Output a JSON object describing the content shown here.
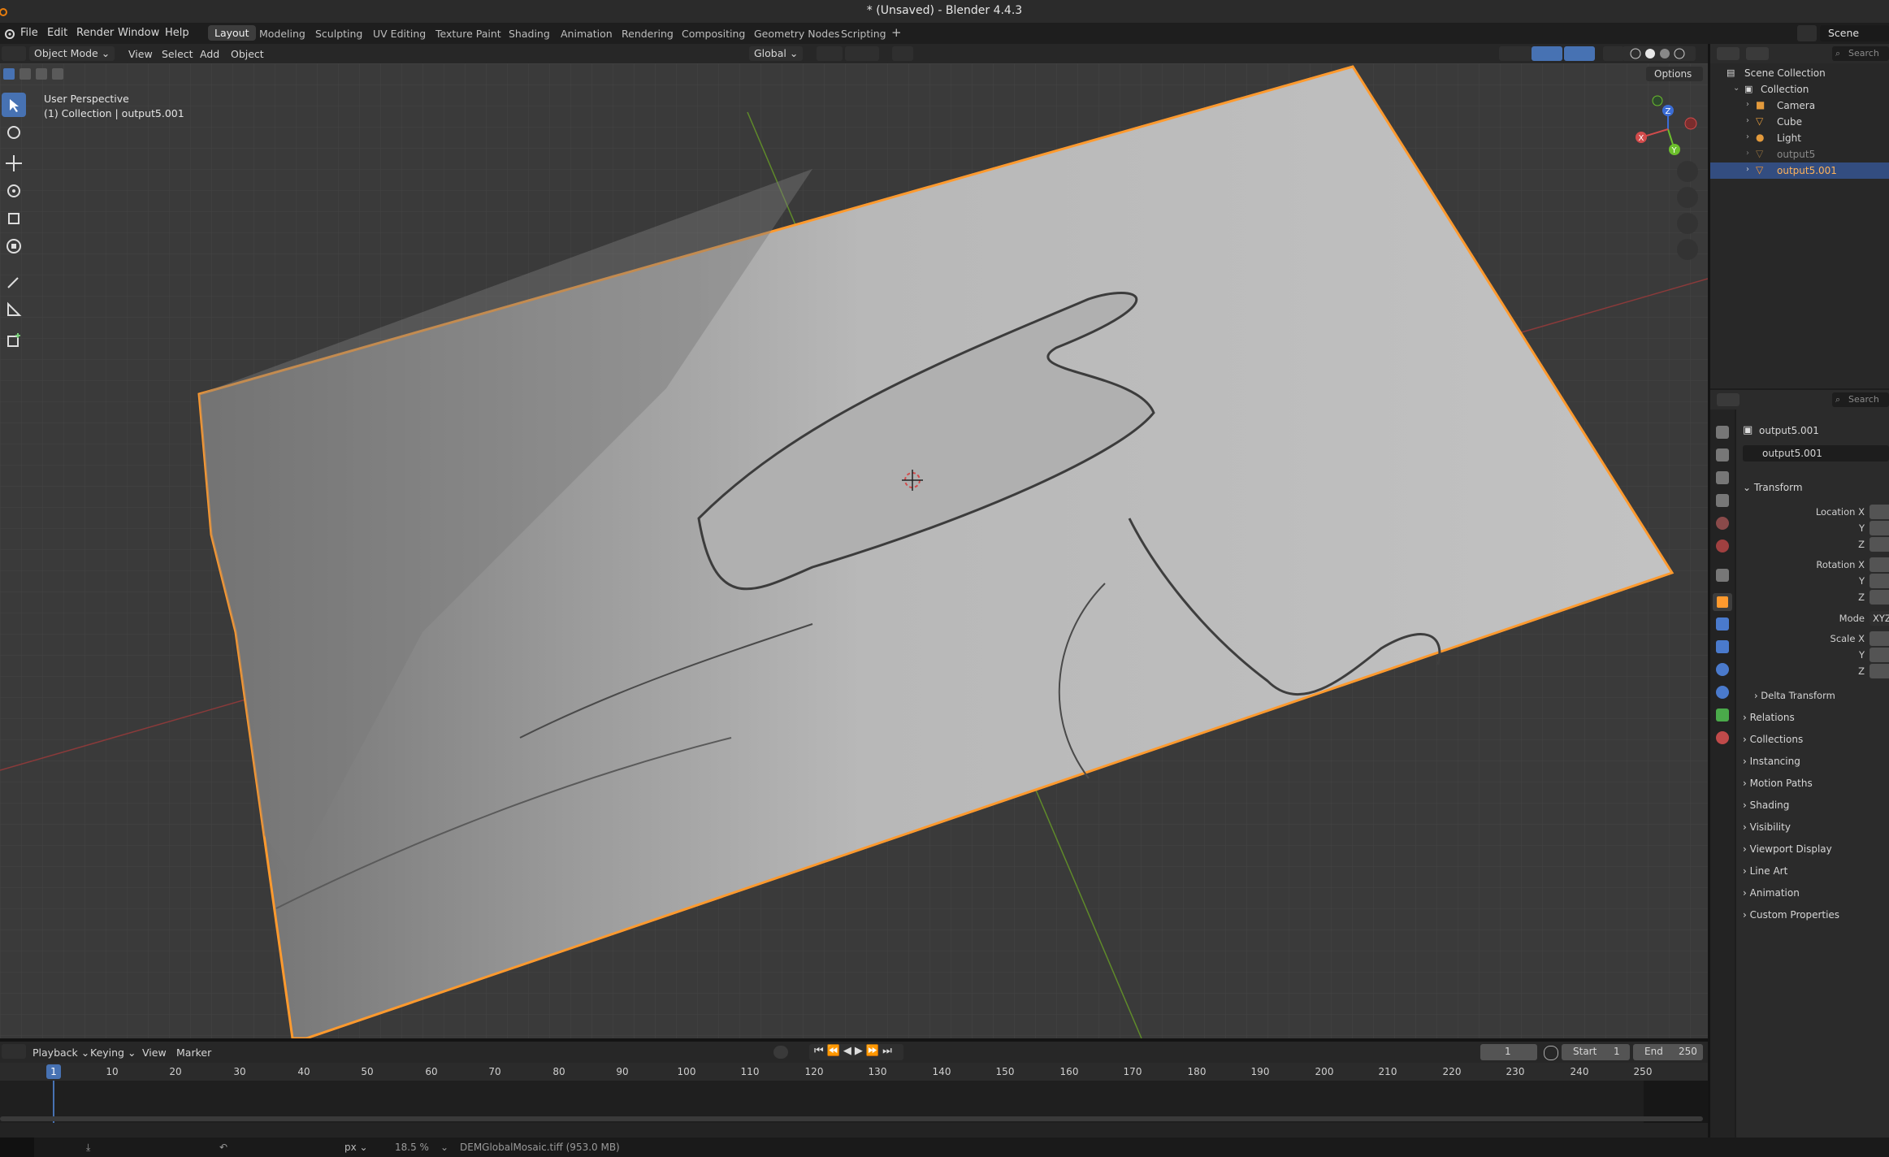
{
  "window": {
    "title": "* (Unsaved) - Blender 4.4.3"
  },
  "menu": {
    "file": "File",
    "edit": "Edit",
    "render": "Render",
    "window": "Window",
    "help": "Help"
  },
  "workspaces": [
    "Layout",
    "Modeling",
    "Sculpting",
    "UV Editing",
    "Texture Paint",
    "Shading",
    "Animation",
    "Rendering",
    "Compositing",
    "Geometry Nodes",
    "Scripting"
  ],
  "active_workspace": "Layout",
  "scene": {
    "label": "Scene"
  },
  "viewport_header": {
    "mode": "Object Mode",
    "view": "View",
    "select": "Select",
    "add": "Add",
    "object": "Object",
    "orientation": "Global",
    "options": "Options"
  },
  "viewport": {
    "perspective": "User Perspective",
    "collection_info": "(1) Collection | output5.001",
    "gizmo": {
      "x": "X",
      "y": "Y",
      "z": "Z"
    }
  },
  "outliner": {
    "search_placeholder": "Search",
    "root": "Scene Collection",
    "collection": "Collection",
    "items": [
      {
        "name": "Camera",
        "selected": false,
        "dim": false
      },
      {
        "name": "Cube",
        "selected": false,
        "dim": false
      },
      {
        "name": "Light",
        "selected": false,
        "dim": false
      },
      {
        "name": "output5",
        "selected": false,
        "dim": true
      },
      {
        "name": "output5.001",
        "selected": true,
        "dim": false
      }
    ]
  },
  "properties": {
    "search_placeholder": "Search",
    "object_name": "output5.001",
    "object_field": "output5.001",
    "transform": "Transform",
    "location_x": "Location X",
    "y": "Y",
    "z": "Z",
    "rotation_x": "Rotation X",
    "mode": "Mode",
    "mode_value": "XYZ",
    "scale_x": "Scale X",
    "delta_transform": "Delta Transform",
    "sections": [
      "Relations",
      "Collections",
      "Instancing",
      "Motion Paths",
      "Shading",
      "Visibility",
      "Viewport Display",
      "Line Art",
      "Animation",
      "Custom Properties"
    ]
  },
  "timeline": {
    "playback": "Playback",
    "keying": "Keying",
    "view": "View",
    "marker": "Marker",
    "current_frame": "1",
    "start_label": "Start",
    "start": "1",
    "end_label": "End",
    "end": "250",
    "ticks": [
      "1",
      "10",
      "20",
      "30",
      "40",
      "50",
      "60",
      "70",
      "80",
      "90",
      "100",
      "110",
      "120",
      "130",
      "140",
      "150",
      "160",
      "170",
      "180",
      "190",
      "200",
      "210",
      "220",
      "230",
      "240",
      "250"
    ]
  },
  "statusbar": {
    "unit": "px",
    "zoom": "18.5 %",
    "file": "DEMGlobalMosaic.tiff (953.0 MB)"
  },
  "colors": {
    "accent": "#4772b3",
    "selection_outline": "#ff9a2e",
    "terrain": "#b8b8b8"
  }
}
